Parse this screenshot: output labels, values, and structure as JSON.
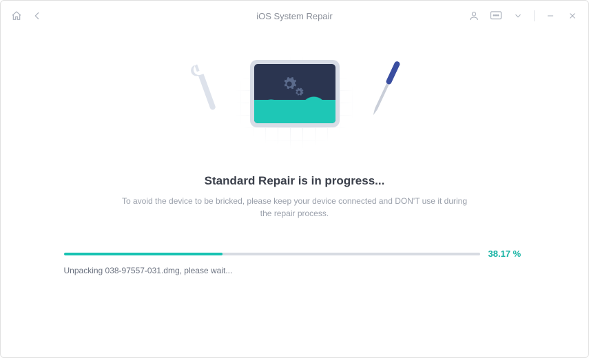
{
  "header": {
    "title": "iOS System Repair"
  },
  "main": {
    "heading": "Standard Repair is in progress...",
    "subtext": "To avoid the device to be bricked, please keep your device connected and DON'T use it during the repair process."
  },
  "progress": {
    "percent_value": 38.17,
    "percent_label": "38.17 %",
    "fill_width": "38.17%",
    "status": "Unpacking 038-97557-031.dmg, please wait..."
  },
  "colors": {
    "accent": "#17c3b2",
    "text_muted": "#9aa0ab"
  }
}
